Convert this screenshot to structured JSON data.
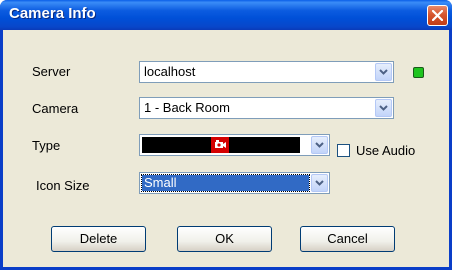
{
  "window": {
    "title": "Camera Info"
  },
  "fields": {
    "server": {
      "label": "Server",
      "value": "localhost",
      "status_color": "#1fc41f"
    },
    "camera": {
      "label": "Camera",
      "value": "1 - Back Room"
    },
    "type": {
      "label": "Type",
      "use_audio_label": "Use Audio",
      "use_audio_checked": false
    },
    "icon_size": {
      "label": "Icon Size",
      "value": "Small"
    }
  },
  "buttons": {
    "delete": "Delete",
    "ok": "OK",
    "cancel": "Cancel"
  },
  "icons": {
    "close": "close-icon",
    "dropdown": "chevron-down-icon",
    "camera": "camera-icon"
  }
}
